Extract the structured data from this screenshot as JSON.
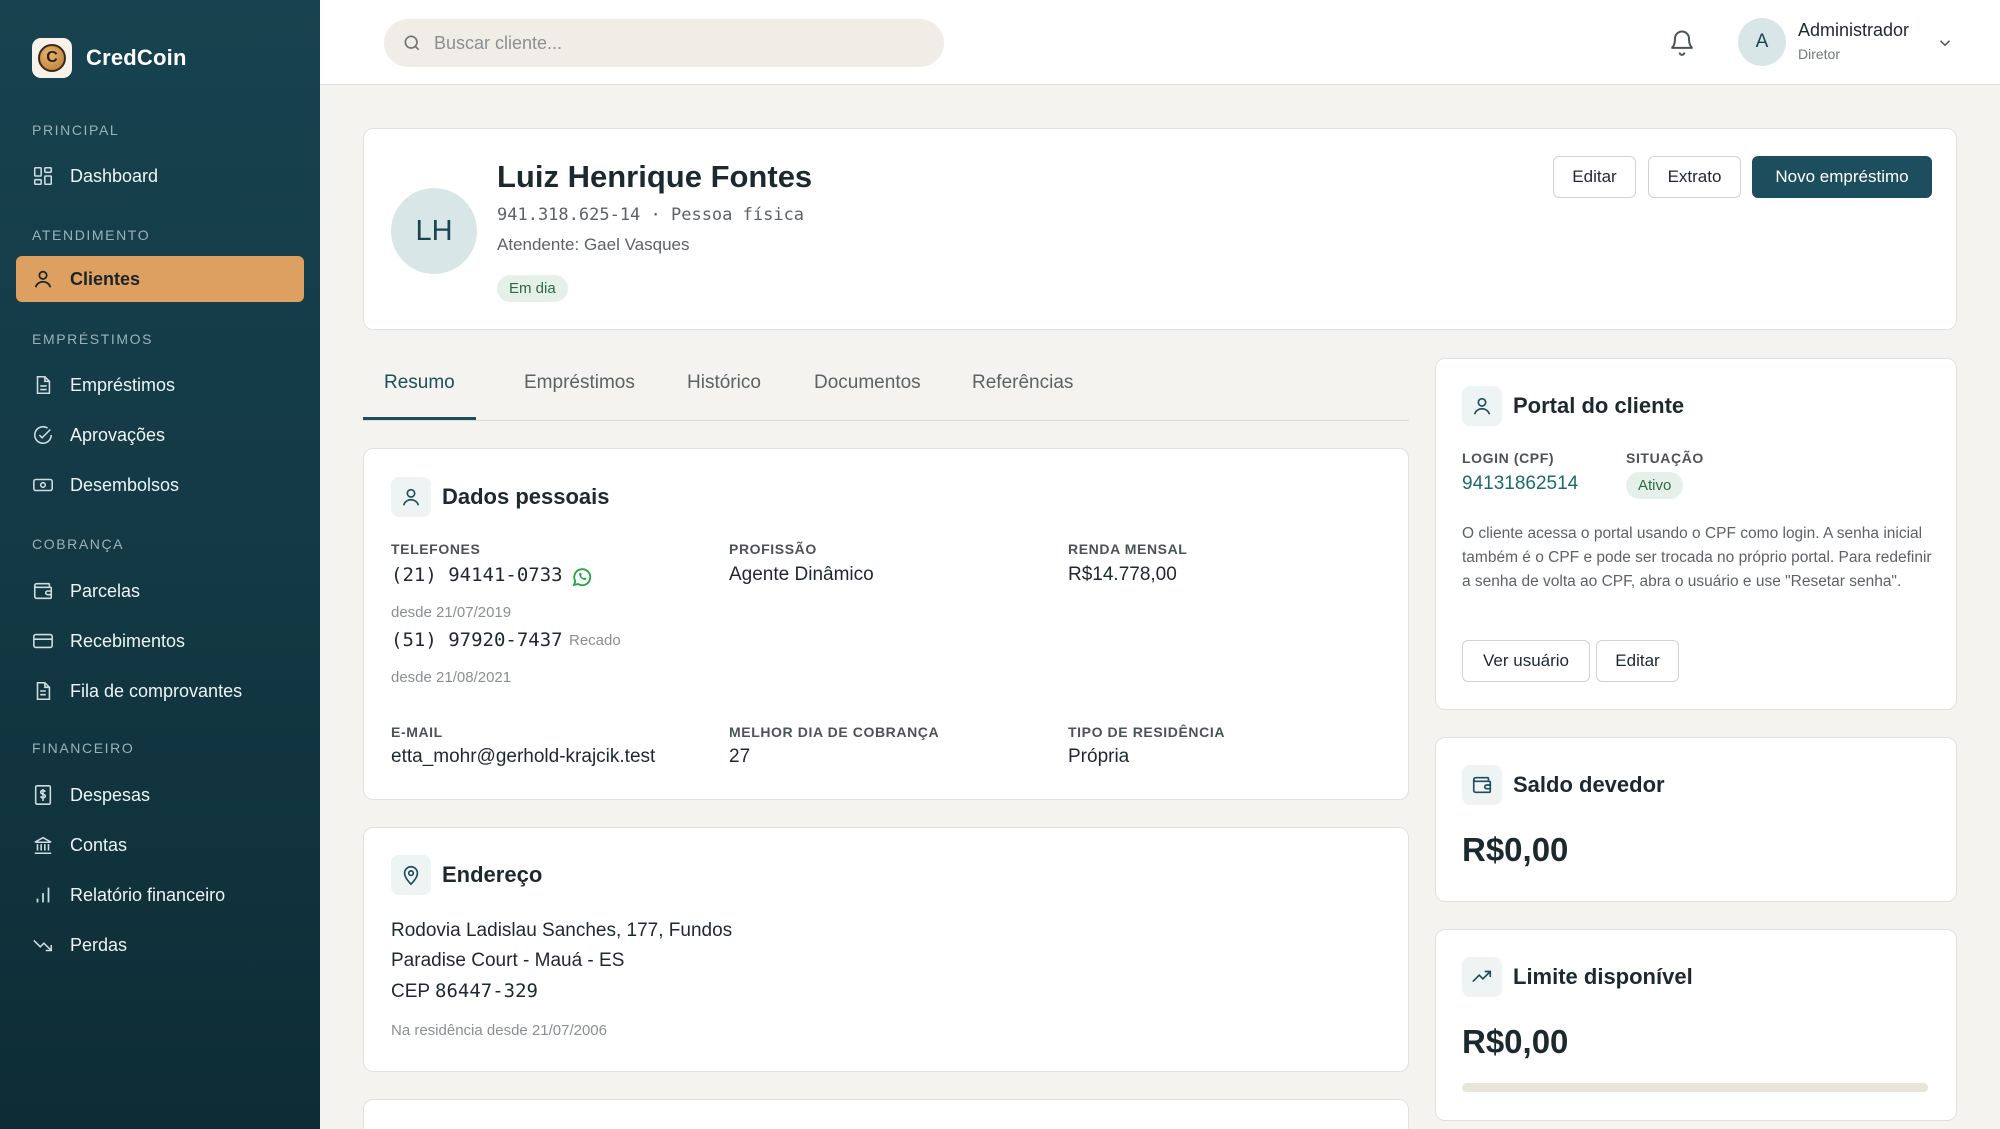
{
  "brand": {
    "name": "CredCoin",
    "logo_letter": "C"
  },
  "sidebar": {
    "sections": [
      {
        "heading": "PRINCIPAL",
        "items": [
          {
            "label": "Dashboard",
            "icon": "dashboard-icon"
          }
        ]
      },
      {
        "heading": "ATENDIMENTO",
        "items": [
          {
            "label": "Clientes",
            "icon": "user-icon",
            "active": true
          }
        ]
      },
      {
        "heading": "EMPRÉSTIMOS",
        "items": [
          {
            "label": "Empréstimos",
            "icon": "document-icon"
          },
          {
            "label": "Aprovações",
            "icon": "check-circle-icon"
          },
          {
            "label": "Desembolsos",
            "icon": "banknote-icon"
          }
        ]
      },
      {
        "heading": "COBRANÇA",
        "items": [
          {
            "label": "Parcelas",
            "icon": "wallet-icon"
          },
          {
            "label": "Recebimentos",
            "icon": "credit-card-icon"
          },
          {
            "label": "Fila de comprovantes",
            "icon": "receipt-icon"
          }
        ]
      },
      {
        "heading": "FINANCEIRO",
        "items": [
          {
            "label": "Despesas",
            "icon": "dollar-receipt-icon"
          },
          {
            "label": "Contas",
            "icon": "bank-icon"
          },
          {
            "label": "Relatório financeiro",
            "icon": "bar-chart-icon"
          },
          {
            "label": "Perdas",
            "icon": "trending-down-icon"
          }
        ]
      }
    ]
  },
  "topbar": {
    "search_placeholder": "Buscar cliente...",
    "user": {
      "initial": "A",
      "name": "Administrador",
      "role": "Diretor"
    }
  },
  "client": {
    "initials": "LH",
    "name": "Luiz Henrique Fontes",
    "doc_line": "941.318.625-14 · Pessoa física",
    "agent": "Atendente: Gael Vasques",
    "status": "Em dia",
    "actions": {
      "edit": "Editar",
      "statement": "Extrato",
      "new_loan": "Novo empréstimo"
    }
  },
  "tabs": [
    "Resumo",
    "Empréstimos",
    "Histórico",
    "Documentos",
    "Referências"
  ],
  "personal": {
    "title": "Dados pessoais",
    "phones_label": "TELEFONES",
    "phones": [
      {
        "number": "(21) 94141-0733",
        "since": "desde 21/07/2019",
        "tag": ""
      },
      {
        "number": "(51) 97920-7437",
        "since": "desde 21/08/2021",
        "tag": "Recado"
      }
    ],
    "profession_label": "PROFISSÃO",
    "profession": "Agente Dinâmico",
    "income_label": "RENDA MENSAL",
    "income": "R$14.778,00",
    "email_label": "E-MAIL",
    "email": "etta_mohr@gerhold-krajcik.test",
    "billing_day_label": "MELHOR DIA DE COBRANÇA",
    "billing_day": "27",
    "residence_label": "TIPO DE RESIDÊNCIA",
    "residence": "Própria"
  },
  "address": {
    "title": "Endereço",
    "line1": "Rodovia Ladislau Sanches, 177, Fundos",
    "line2": "Paradise Court - Mauá - ES",
    "cep_label": "CEP",
    "cep": "86447-329",
    "since": "Na residência desde 21/07/2006"
  },
  "portal": {
    "title": "Portal do cliente",
    "login_label": "LOGIN (CPF)",
    "login": "94131862514",
    "status_label": "SITUAÇÃO",
    "status": "Ativo",
    "description": "O cliente acessa o portal usando o CPF como login. A senha inicial também é o CPF e pode ser trocada no próprio portal. Para redefinir a senha de volta ao CPF, abra o usuário e use \"Resetar senha\".",
    "view_user": "Ver usuário",
    "edit": "Editar"
  },
  "balance": {
    "title": "Saldo devedor",
    "amount": "R$0,00"
  },
  "limit": {
    "title": "Limite disponível",
    "amount": "R$0,00",
    "used_fraction": 0
  },
  "colors": {
    "primary": "#1c4e5d",
    "accent": "#dda060",
    "sidebar": "#123843",
    "success": "#2c6b43"
  }
}
